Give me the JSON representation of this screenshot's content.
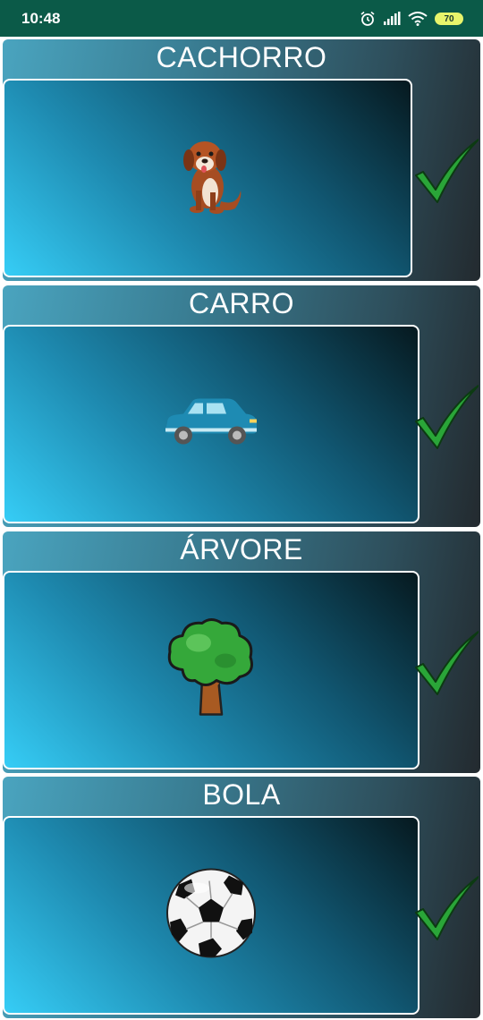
{
  "status_bar": {
    "time": "10:48",
    "battery": "70",
    "icons": [
      "alarm-icon",
      "signal-icon",
      "wifi-icon",
      "battery-icon"
    ]
  },
  "cards": [
    {
      "title": "CACHORRO",
      "image": "dog-image",
      "status": "check-icon"
    },
    {
      "title": "CARRO",
      "image": "car-image",
      "status": "check-icon"
    },
    {
      "title": "ÁRVORE",
      "image": "tree-image",
      "status": "check-icon"
    },
    {
      "title": "BOLA",
      "image": "ball-image",
      "status": "check-icon"
    }
  ],
  "colors": {
    "status_bar": "#0b5a48",
    "check": "#2aa538",
    "panel_light": "#36cdf6",
    "panel_dark": "#06191f"
  }
}
